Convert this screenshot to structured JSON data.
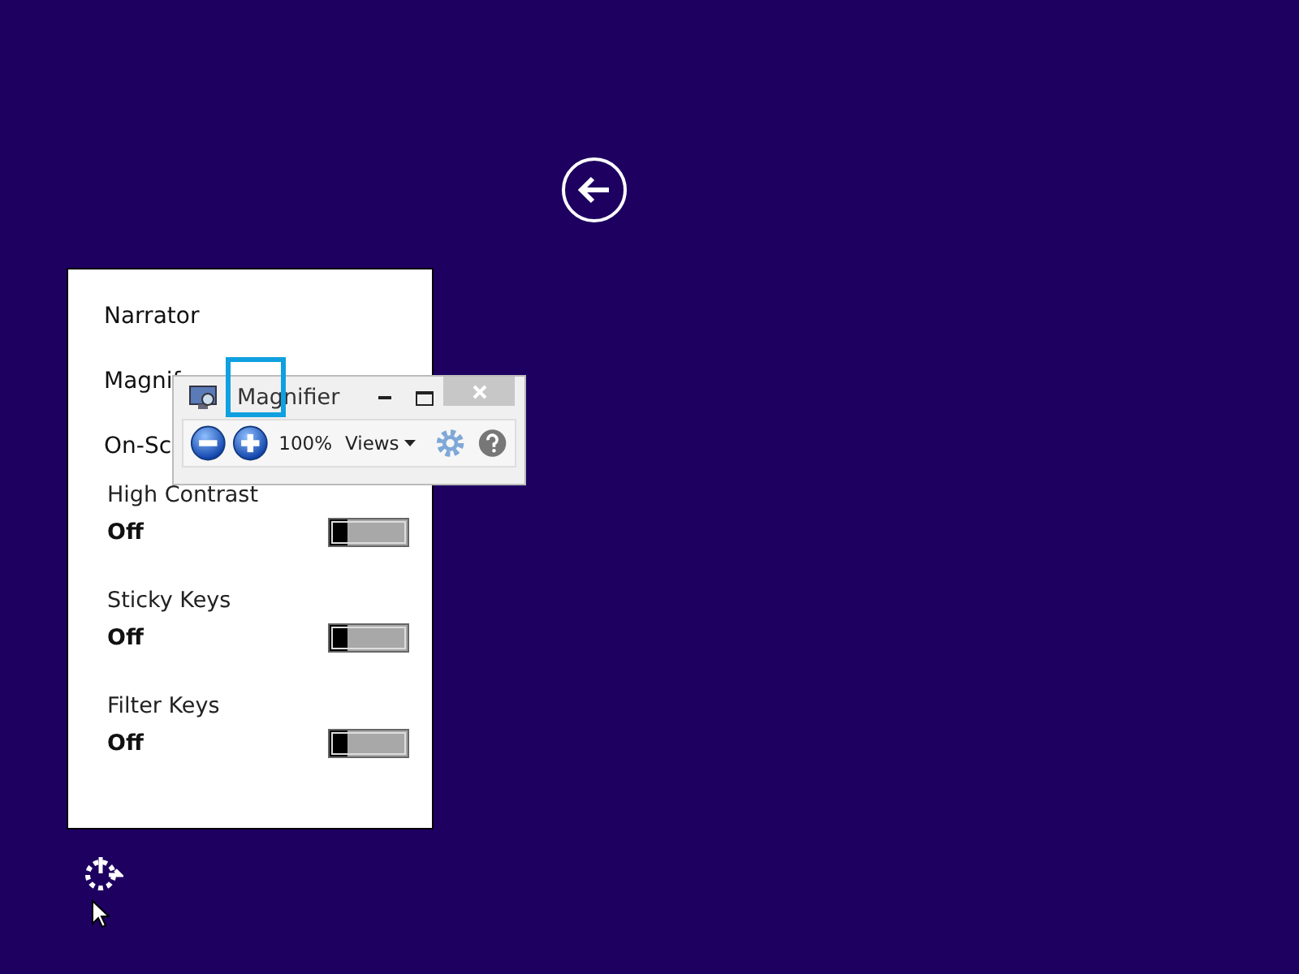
{
  "panel": {
    "items": [
      "Narrator",
      "Magnif",
      "On-Sc"
    ],
    "toggles": [
      {
        "label": "High Contrast",
        "value": "Off",
        "on": false
      },
      {
        "label": "Sticky Keys",
        "value": "Off",
        "on": false
      },
      {
        "label": "Filter Keys",
        "value": "Off",
        "on": false
      }
    ]
  },
  "magnifier": {
    "title": "Magnifier",
    "zoom": "100%",
    "views": "Views"
  }
}
